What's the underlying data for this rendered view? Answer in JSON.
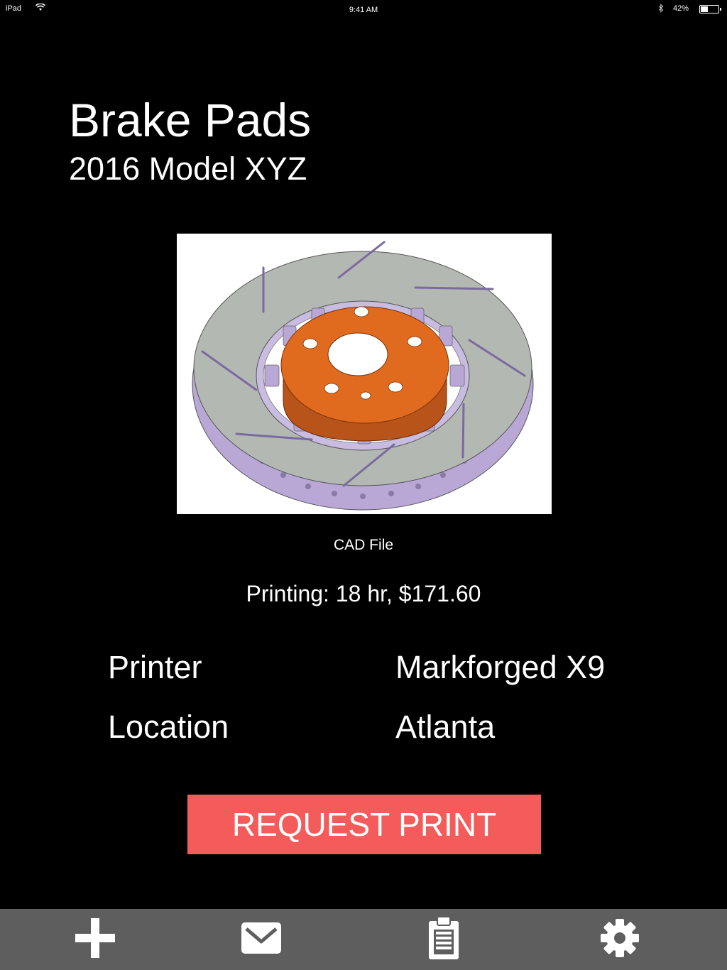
{
  "status_bar": {
    "device": "iPad",
    "time": "9:41 AM",
    "battery_percent": "42%",
    "battery_level": 0.42
  },
  "part": {
    "title": "Brake Pads",
    "subtitle": "2016 Model XYZ"
  },
  "cad": {
    "caption": "CAD File"
  },
  "printing": {
    "summary": "Printing: 18 hr, $171.60"
  },
  "details": [
    {
      "label": "Printer",
      "value": "Markforged X9"
    },
    {
      "label": "Location",
      "value": "Atlanta"
    }
  ],
  "actions": {
    "request_print": "REQUEST PRINT"
  },
  "colors": {
    "background": "#000000",
    "button": "#f45b5b",
    "tab_bar": "#5e5e5e",
    "rotor": "#b4b8b3",
    "hub": "#d9661f",
    "vanes": "#b9a8d6"
  },
  "tab_bar": {
    "items": [
      {
        "icon": "plus-icon"
      },
      {
        "icon": "mail-icon"
      },
      {
        "icon": "clipboard-icon"
      },
      {
        "icon": "gear-icon"
      }
    ]
  }
}
